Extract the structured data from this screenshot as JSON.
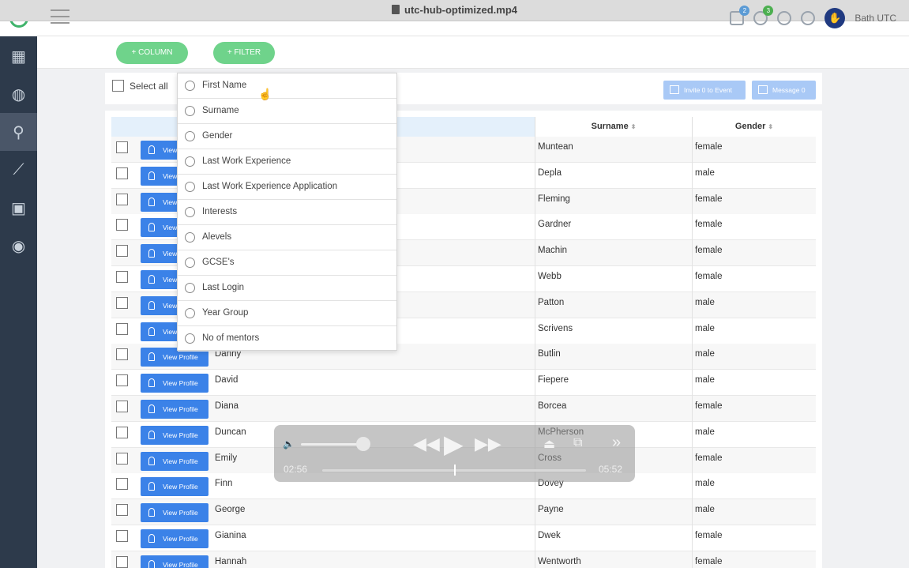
{
  "window": {
    "title": "utc-hub-optimized.mp4"
  },
  "sidebar": {
    "items": [
      {
        "icon": "dashboard-icon",
        "glyph": "▦"
      },
      {
        "icon": "globe-icon",
        "glyph": "◍"
      },
      {
        "icon": "search-icon",
        "glyph": "⚲"
      },
      {
        "icon": "chart-icon",
        "glyph": "⟋"
      },
      {
        "icon": "calendar-icon",
        "glyph": "▣"
      },
      {
        "icon": "eye-icon",
        "glyph": "◉"
      }
    ]
  },
  "header": {
    "messages_count": "2",
    "notifications_count": "3",
    "user_name": "Bath UTC"
  },
  "toolbar": {
    "add_column_label": "+ COLUMN",
    "add_filter_label": "+ FILTER"
  },
  "selection": {
    "select_all_label": "Select all",
    "invite_label": "Invite 0 to Event",
    "message_label": "Message 0"
  },
  "table": {
    "headers": {
      "surname": "Surname",
      "gender": "Gender",
      "sort_glyph": "⬍"
    },
    "view_profile_label": "View Profile",
    "rows": [
      {
        "first": "",
        "surname": "Muntean",
        "gender": "female"
      },
      {
        "first": "",
        "surname": "Depla",
        "gender": "male"
      },
      {
        "first": "",
        "surname": "Fleming",
        "gender": "female"
      },
      {
        "first": "",
        "surname": "Gardner",
        "gender": "female"
      },
      {
        "first": "",
        "surname": "Machin",
        "gender": "female"
      },
      {
        "first": "",
        "surname": "Webb",
        "gender": "female"
      },
      {
        "first": "",
        "surname": "Patton",
        "gender": "male"
      },
      {
        "first": "",
        "surname": "Scrivens",
        "gender": "male"
      },
      {
        "first": "Danny",
        "surname": "Butlin",
        "gender": "male"
      },
      {
        "first": "David",
        "surname": "Fiepere",
        "gender": "male"
      },
      {
        "first": "Diana",
        "surname": "Borcea",
        "gender": "female"
      },
      {
        "first": "Duncan",
        "surname": "McPherson",
        "gender": "male"
      },
      {
        "first": "Emily",
        "surname": "Cross",
        "gender": "female"
      },
      {
        "first": "Finn",
        "surname": "Dovey",
        "gender": "male"
      },
      {
        "first": "George",
        "surname": "Payne",
        "gender": "male"
      },
      {
        "first": "Gianina",
        "surname": "Dwek",
        "gender": "female"
      },
      {
        "first": "Hannah",
        "surname": "Wentworth",
        "gender": "female"
      }
    ]
  },
  "filter_dropdown": {
    "options": [
      "First Name",
      "Surname",
      "Gender",
      "Last Work Experience",
      "Last Work Experience Application",
      "Interests",
      "Alevels",
      "GCSE's",
      "Last Login",
      "Year Group",
      "No of mentors"
    ]
  },
  "video": {
    "current_time": "02:56",
    "duration": "05:52",
    "progress": 0.5
  }
}
